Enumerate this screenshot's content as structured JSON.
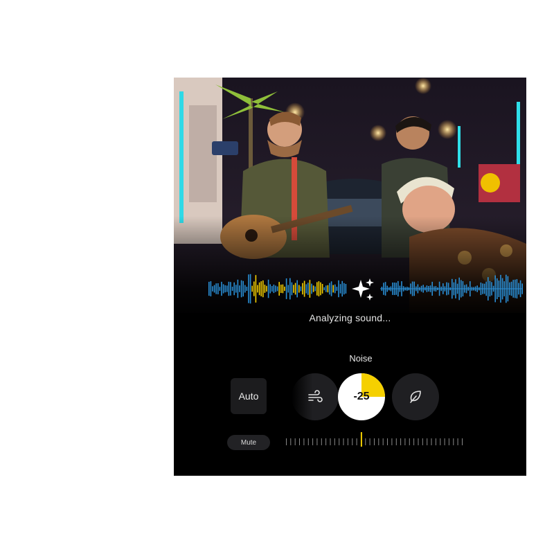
{
  "status": {
    "analyzing_text": "Analyzing sound..."
  },
  "noise_panel": {
    "title": "Noise",
    "auto_label": "Auto",
    "level_value": "-25",
    "level_fraction": 0.25,
    "mute_label": "Mute"
  },
  "icons": {
    "wind": "wind-icon",
    "leaf": "leaf-icon",
    "sparkle": "sparkle-icon"
  },
  "colors": {
    "accent_yellow": "#f5d000",
    "wave_blue": "#2a8fd6",
    "panel_bg": "#000000",
    "button_bg": "#1f1f22"
  }
}
